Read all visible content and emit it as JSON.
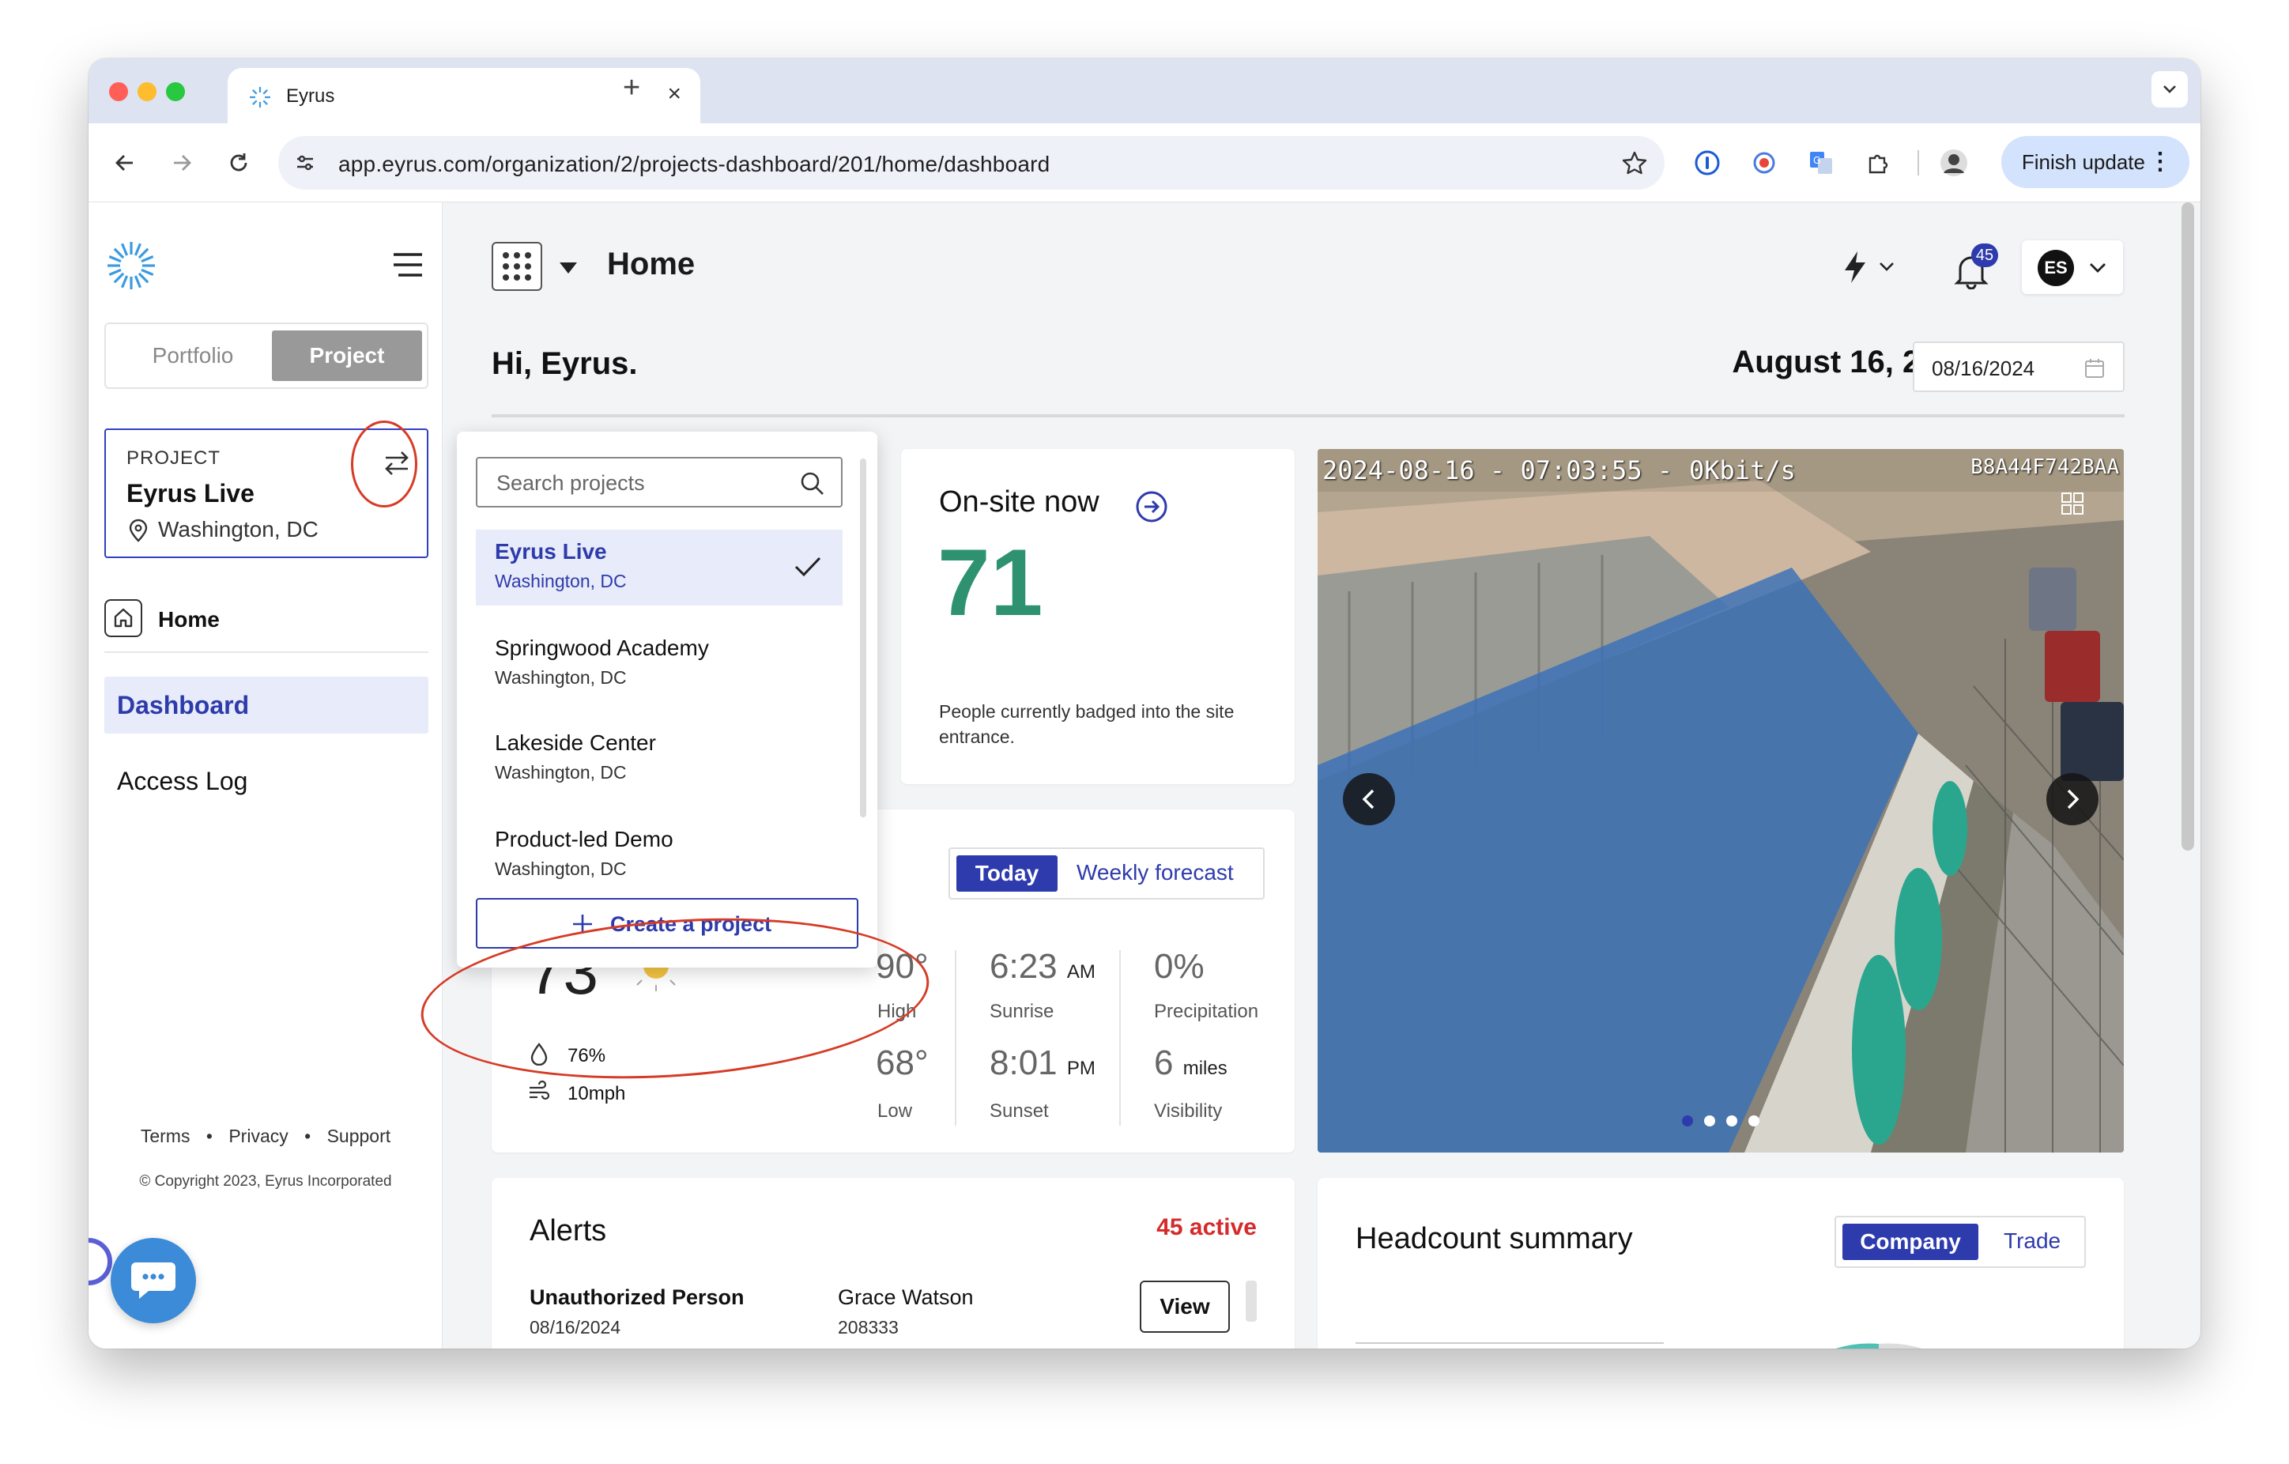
{
  "browser": {
    "tab_title": "Eyrus",
    "url": "app.eyrus.com/organization/2/projects-dashboard/201/home/dashboard",
    "finish_update": "Finish update"
  },
  "sidebar": {
    "seg_portfolio": "Portfolio",
    "seg_project": "Project",
    "project_label": "PROJECT",
    "project_name": "Eyrus Live",
    "project_location": "Washington, DC",
    "home": "Home",
    "dashboard": "Dashboard",
    "access_log": "Access Log",
    "footer_terms": "Terms",
    "footer_privacy": "Privacy",
    "footer_support": "Support",
    "copyright": "© Copyright 2023, Eyrus Incorporated"
  },
  "header": {
    "title": "Home",
    "notification_count": "45",
    "user_initials": "ES"
  },
  "greeting": "Hi, Eyrus.",
  "date_display": "August 16, 2024",
  "date_input": "08/16/2024",
  "onsite": {
    "title": "On-site now",
    "count": "71",
    "description": "People currently badged into the site entrance."
  },
  "weather": {
    "tab_today": "Today",
    "tab_weekly": "Weekly forecast",
    "current_temp": "73",
    "humidity": "76%",
    "wind": "10mph",
    "high": "90°",
    "high_label": "High",
    "low": "68°",
    "low_label": "Low",
    "sunrise": "6:23",
    "sunrise_unit": "AM",
    "sunrise_label": "Sunrise",
    "sunset": "8:01",
    "sunset_unit": "PM",
    "sunset_label": "Sunset",
    "precip": "0%",
    "precip_label": "Precipitation",
    "visibility": "6",
    "visibility_unit": "miles",
    "visibility_label": "Visibility"
  },
  "camera": {
    "overlay_time": "2024-08-16 - 07:03:55 -",
    "overlay_rate": "0Kbit/s",
    "overlay_id": "B8A44F742BAA"
  },
  "alerts": {
    "title": "Alerts",
    "count": "45 active",
    "rows": [
      {
        "type": "Unauthorized Person",
        "date": "08/16/2024",
        "person": "Grace Watson",
        "id": "208333",
        "action": "View"
      }
    ]
  },
  "headcount": {
    "title": "Headcount summary",
    "tab_company": "Company",
    "tab_trade": "Trade"
  },
  "dropdown": {
    "search_placeholder": "Search projects",
    "projects": [
      {
        "name": "Eyrus Live",
        "location": "Washington, DC"
      },
      {
        "name": "Springwood Academy",
        "location": "Washington, DC"
      },
      {
        "name": "Lakeside Center",
        "location": "Washington, DC"
      },
      {
        "name": "Product-led Demo",
        "location": "Washington, DC"
      }
    ],
    "create_label": "Create a project"
  },
  "colors": {
    "brand_blue": "#2e3bad",
    "onsite_green": "#2e9271",
    "alert_red": "#d42b2b",
    "annotation_red": "#d63b26"
  }
}
